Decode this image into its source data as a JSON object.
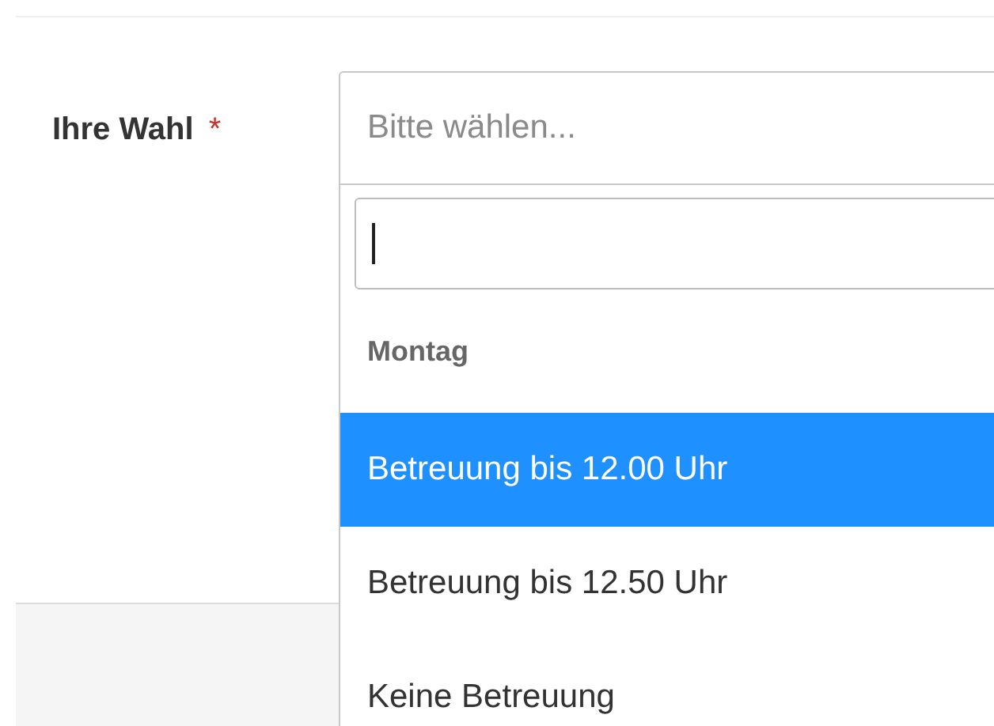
{
  "field": {
    "label": "Ihre Wahl",
    "required_mark": "*",
    "placeholder": "Bitte wählen...",
    "open": true
  },
  "dropdown": {
    "groups": [
      {
        "label": "Montag",
        "options": [
          {
            "label": "Betreuung bis 12.00 Uhr",
            "selected": true
          },
          {
            "label": "Betreuung bis 12.50 Uhr",
            "selected": false
          },
          {
            "label": "Keine Betreuung",
            "selected": false
          }
        ]
      }
    ]
  }
}
